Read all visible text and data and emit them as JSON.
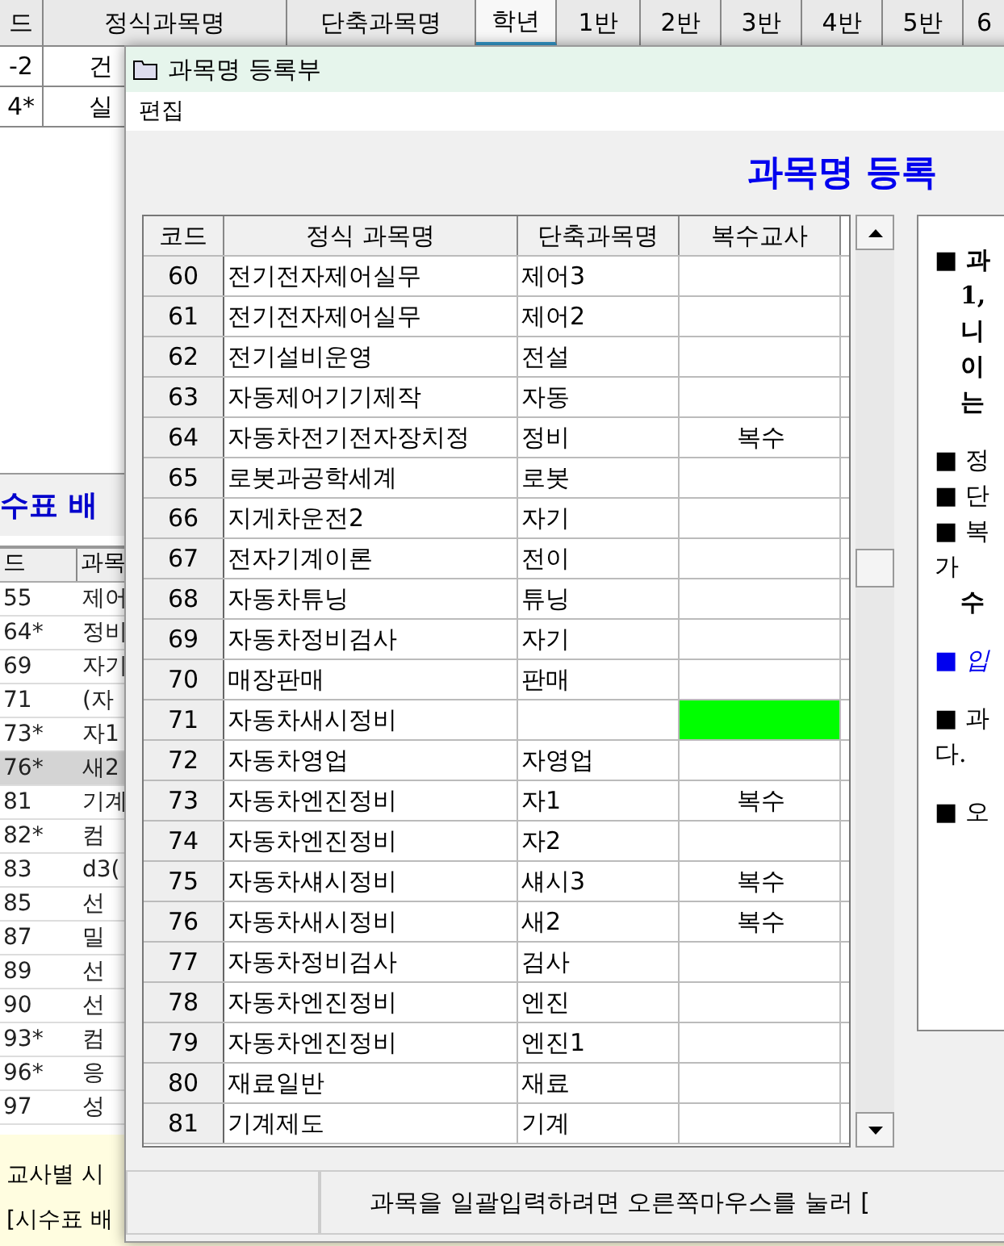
{
  "background_window": {
    "columns": [
      {
        "label": "드",
        "selected": false
      },
      {
        "label": "정식과목명",
        "selected": false
      },
      {
        "label": "단축과목명",
        "selected": false
      },
      {
        "label": "학년",
        "selected": true
      },
      {
        "label": "1반",
        "selected": false
      },
      {
        "label": "2반",
        "selected": false
      },
      {
        "label": "3반",
        "selected": false
      },
      {
        "label": "4반",
        "selected": false
      },
      {
        "label": "5반",
        "selected": false
      },
      {
        "label": "6",
        "selected": false
      }
    ],
    "rows": [
      {
        "code": "-2",
        "name": "건"
      },
      {
        "code": "4*",
        "name": "실"
      }
    ],
    "section_title": "수표 배",
    "list_columns": [
      "드",
      "과목"
    ],
    "list_rows": [
      {
        "code": "55",
        "name": "제어",
        "selected": false
      },
      {
        "code": "64*",
        "name": "정비",
        "selected": false
      },
      {
        "code": "69",
        "name": "자기",
        "selected": false
      },
      {
        "code": "71",
        "name": "(자",
        "selected": false
      },
      {
        "code": "73*",
        "name": "자1",
        "selected": false
      },
      {
        "code": "76*",
        "name": "새2",
        "selected": true
      },
      {
        "code": "81",
        "name": "기계",
        "selected": false
      },
      {
        "code": "82*",
        "name": "컴",
        "selected": false
      },
      {
        "code": "83",
        "name": "d3(",
        "selected": false
      },
      {
        "code": "85",
        "name": "선",
        "selected": false
      },
      {
        "code": "87",
        "name": "밀",
        "selected": false
      },
      {
        "code": "89",
        "name": "선",
        "selected": false
      },
      {
        "code": "90",
        "name": "선",
        "selected": false
      },
      {
        "code": "93*",
        "name": "컴",
        "selected": false
      },
      {
        "code": "96*",
        "name": "응",
        "selected": false
      },
      {
        "code": "97",
        "name": "성",
        "selected": false
      }
    ],
    "notes": [
      "교사별 시",
      "[시수표 배"
    ]
  },
  "dialog": {
    "title": "과목명 등록부",
    "menu": [
      "편집"
    ],
    "heading": "과목명 등록",
    "table": {
      "columns": [
        "코드",
        "정식 과목명",
        "단축과목명",
        "복수교사"
      ],
      "rows": [
        {
          "code": "60",
          "name": "전기전자제어실무",
          "short": "제어3"
        },
        {
          "code": "61",
          "name": "전기전자제어실무",
          "short": "제어2"
        },
        {
          "code": "62",
          "name": "전기설비운영",
          "short": "전설"
        },
        {
          "code": "63",
          "name": "자동제어기기제작",
          "short": "자동"
        },
        {
          "code": "64",
          "name": "자동차전기전자장치정",
          "short": "정비",
          "multi": "복수"
        },
        {
          "code": "65",
          "name": "로봇과공학세계",
          "short": "로봇"
        },
        {
          "code": "66",
          "name": "지게차운전2",
          "short": "자기"
        },
        {
          "code": "67",
          "name": "전자기계이론",
          "short": "전이"
        },
        {
          "code": "68",
          "name": "자동차튜닝",
          "short": "튜닝"
        },
        {
          "code": "69",
          "name": "자동차정비검사",
          "short": "자기"
        },
        {
          "code": "70",
          "name": "매장판매",
          "short": "판매"
        },
        {
          "code": "71",
          "name": "자동차새시정비",
          "color": "#00ff00"
        },
        {
          "code": "72",
          "name": "자동차영업",
          "short": "자영업"
        },
        {
          "code": "73",
          "name": "자동차엔진정비",
          "short": "자1",
          "multi": "복수"
        },
        {
          "code": "74",
          "name": "자동차엔진정비",
          "short": "자2"
        },
        {
          "code": "75",
          "name": "자동차섀시정비",
          "short": "섀시3",
          "multi": "복수"
        },
        {
          "code": "76",
          "name": "자동차새시정비",
          "short": "새2",
          "multi": "복수"
        },
        {
          "code": "77",
          "name": "자동차정비검사",
          "short": "검사"
        },
        {
          "code": "78",
          "name": "자동차엔진정비",
          "short": "엔진"
        },
        {
          "code": "79",
          "name": "자동차엔진정비",
          "short": "엔진1"
        },
        {
          "code": "80",
          "name": "재료일반",
          "short": "재료"
        },
        {
          "code": "81",
          "name": "기계제도",
          "short": "기계"
        }
      ]
    },
    "help_lines": [
      {
        "text": "■ 과",
        "kind": "bold"
      },
      {
        "text": "1,",
        "kind": "indent"
      },
      {
        "text": "니",
        "kind": "indent"
      },
      {
        "text": "이",
        "kind": "indent"
      },
      {
        "text": "는",
        "kind": "indent"
      },
      {
        "kind": "gap"
      },
      {
        "text": "■ 정",
        "kind": "plain"
      },
      {
        "text": "■ 단",
        "kind": "plain"
      },
      {
        "text": "■ 복",
        "kind": "plain"
      },
      {
        "text": "가",
        "kind": "plain"
      },
      {
        "text": "수",
        "kind": "indent"
      },
      {
        "kind": "gap"
      },
      {
        "text": "■ 입",
        "kind": "link"
      },
      {
        "kind": "gap"
      },
      {
        "text": "■ 과",
        "kind": "plain"
      },
      {
        "text": "다.",
        "kind": "plain"
      },
      {
        "kind": "gap"
      },
      {
        "text": "■ 오",
        "kind": "plain"
      }
    ],
    "status": "과목을 일괄입력하려면 오른쪽마우스를 눌러 ["
  }
}
